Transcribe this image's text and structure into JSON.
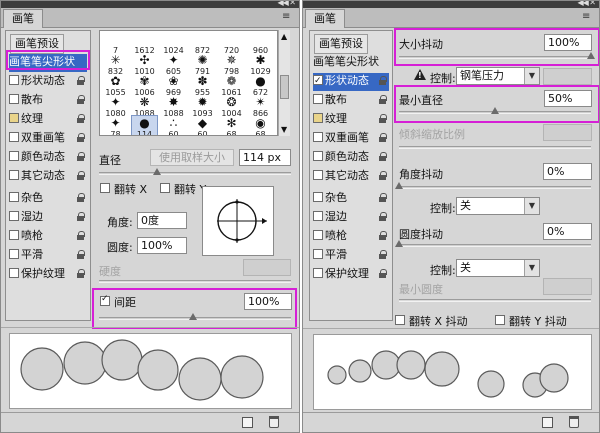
{
  "left": {
    "tab_title": "画笔",
    "menu_icon": "panel-menu-icon",
    "presets_label": "画笔预设",
    "sidebar": [
      {
        "label": "画笔笔尖形状",
        "checkbox": false,
        "lock": false,
        "active": true
      },
      {
        "label": "形状动态",
        "checkbox": true,
        "checked": false,
        "lock": true
      },
      {
        "label": "散布",
        "checkbox": true,
        "checked": false,
        "lock": true
      },
      {
        "label": "纹理",
        "checkbox": true,
        "checked": false,
        "lock": true
      },
      {
        "label": "双重画笔",
        "checkbox": true,
        "checked": false,
        "lock": true
      },
      {
        "label": "颜色动态",
        "checkbox": true,
        "checked": false,
        "lock": true
      },
      {
        "label": "其它动态",
        "checkbox": true,
        "checked": false,
        "lock": true
      },
      {
        "label": "杂色",
        "checkbox": true,
        "checked": false,
        "lock": true
      },
      {
        "label": "湿边",
        "checkbox": true,
        "checked": false,
        "lock": true
      },
      {
        "label": "喷枪",
        "checkbox": true,
        "checked": false,
        "lock": true
      },
      {
        "label": "平滑",
        "checkbox": true,
        "checked": false,
        "lock": true
      },
      {
        "label": "保护纹理",
        "checkbox": true,
        "checked": false,
        "lock": true
      }
    ],
    "brush_tips": [
      {
        "glyph": "",
        "size": "7"
      },
      {
        "glyph": "",
        "size": "1612"
      },
      {
        "glyph": "",
        "size": "1024"
      },
      {
        "glyph": "",
        "size": "872"
      },
      {
        "glyph": "",
        "size": "720"
      },
      {
        "glyph": "",
        "size": "960"
      },
      {
        "glyph": "✳",
        "size": "832"
      },
      {
        "glyph": "✣",
        "size": "1010"
      },
      {
        "glyph": "✦",
        "size": "605"
      },
      {
        "glyph": "✺",
        "size": "791"
      },
      {
        "glyph": "✵",
        "size": "798"
      },
      {
        "glyph": "✱",
        "size": "1029"
      },
      {
        "glyph": "✿",
        "size": "1055"
      },
      {
        "glyph": "✾",
        "size": "1006"
      },
      {
        "glyph": "❀",
        "size": "969"
      },
      {
        "glyph": "✽",
        "size": "955"
      },
      {
        "glyph": "❁",
        "size": "1061"
      },
      {
        "glyph": "●",
        "size": "672"
      },
      {
        "glyph": "✦",
        "size": "1080"
      },
      {
        "glyph": "❋",
        "size": "1088"
      },
      {
        "glyph": "✸",
        "size": "1088"
      },
      {
        "glyph": "✹",
        "size": "1093"
      },
      {
        "glyph": "❂",
        "size": "1004"
      },
      {
        "glyph": "✴",
        "size": "866"
      },
      {
        "glyph": "✦",
        "size": "78"
      },
      {
        "glyph": "●",
        "size": "114"
      },
      {
        "glyph": "∴",
        "size": "60"
      },
      {
        "glyph": "◆",
        "size": "60"
      },
      {
        "glyph": "✻",
        "size": "68"
      },
      {
        "glyph": "◉",
        "size": "68"
      }
    ],
    "diameter": {
      "label": "直径",
      "use_sample_label": "使用取样大小",
      "value": "114 px",
      "fraction": 0.3
    },
    "flip_x": {
      "label": "翻转 X",
      "checked": false
    },
    "flip_y": {
      "label": "翻转 Y",
      "checked": false
    },
    "angle": {
      "label": "角度:",
      "value": "0度"
    },
    "roundness": {
      "label": "圆度:",
      "value": "100%"
    },
    "hardness": {
      "label": "硬度",
      "value": ""
    },
    "spacing": {
      "label": "间距",
      "checked": true,
      "value": "100%",
      "fraction": 0.49
    },
    "footer_icons": [
      "new-preset-icon",
      "trash-icon"
    ]
  },
  "right": {
    "tab_title": "画笔",
    "menu_icon": "panel-menu-icon",
    "presets_label": "画笔预设",
    "sidebar": [
      {
        "label": "画笔笔尖形状",
        "checkbox": false,
        "lock": false
      },
      {
        "label": "形状动态",
        "checkbox": true,
        "checked": true,
        "lock": true,
        "active": true
      },
      {
        "label": "散布",
        "checkbox": true,
        "checked": false,
        "lock": true
      },
      {
        "label": "纹理",
        "checkbox": true,
        "checked": false,
        "lock": true
      },
      {
        "label": "双重画笔",
        "checkbox": true,
        "checked": false,
        "lock": true
      },
      {
        "label": "颜色动态",
        "checkbox": true,
        "checked": false,
        "lock": true
      },
      {
        "label": "其它动态",
        "checkbox": true,
        "checked": false,
        "lock": true
      },
      {
        "label": "杂色",
        "checkbox": true,
        "checked": false,
        "lock": true
      },
      {
        "label": "湿边",
        "checkbox": true,
        "checked": false,
        "lock": true
      },
      {
        "label": "喷枪",
        "checkbox": true,
        "checked": false,
        "lock": true
      },
      {
        "label": "平滑",
        "checkbox": true,
        "checked": false,
        "lock": true
      },
      {
        "label": "保护纹理",
        "checkbox": true,
        "checked": false,
        "lock": true
      }
    ],
    "size_jitter": {
      "label": "大小抖动",
      "value": "100%",
      "fraction": 1.0
    },
    "control1": {
      "label": "控制:",
      "value": "钢笔压力"
    },
    "min_diameter": {
      "label": "最小直径",
      "value": "50%",
      "fraction": 0.5
    },
    "tilt_scale": {
      "label": "倾斜缩放比例",
      "value": ""
    },
    "angle_jitter": {
      "label": "角度抖动",
      "value": "0%",
      "fraction": 0.0
    },
    "control2": {
      "label": "控制:",
      "value": "关"
    },
    "roundness_jitter": {
      "label": "圆度抖动",
      "value": "0%",
      "fraction": 0.0
    },
    "control3": {
      "label": "控制:",
      "value": "关"
    },
    "min_roundness": {
      "label": "最小圆度",
      "value": ""
    },
    "flip_x_jitter": {
      "label": "翻转 X 抖动",
      "checked": false
    },
    "flip_y_jitter": {
      "label": "翻转 Y 抖动",
      "checked": false
    },
    "footer_icons": [
      "new-preset-icon",
      "trash-icon"
    ]
  }
}
